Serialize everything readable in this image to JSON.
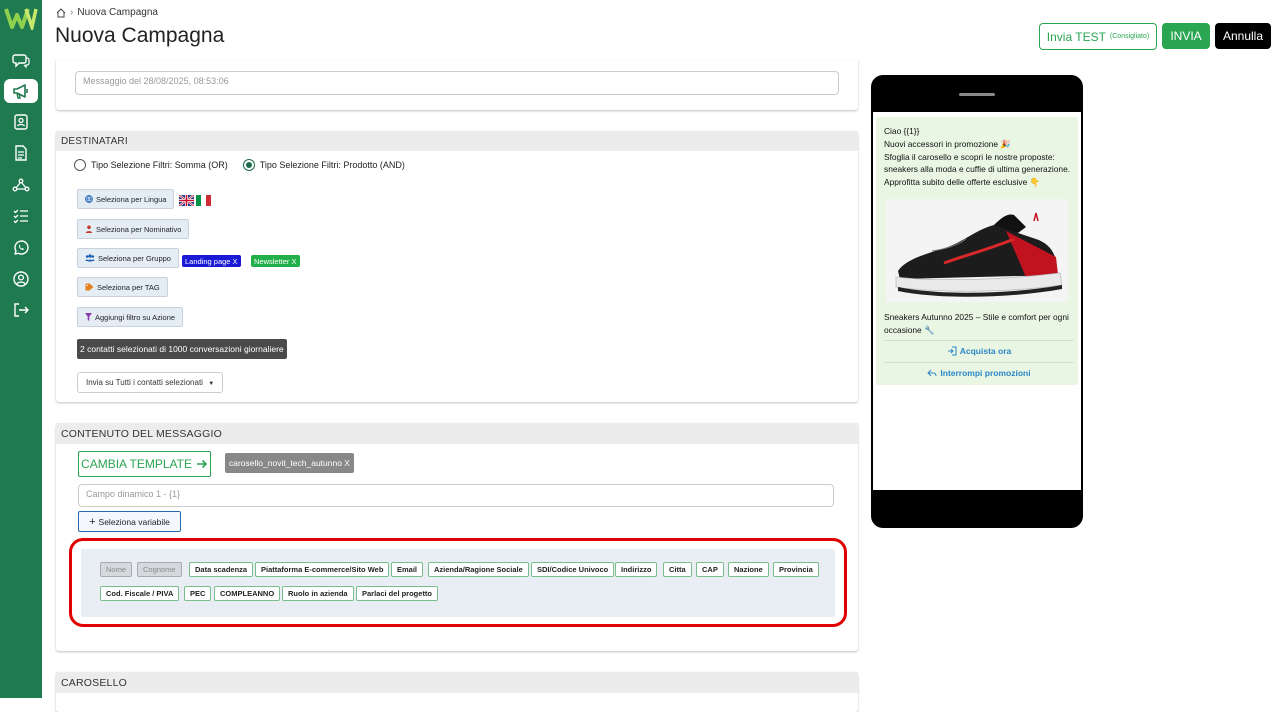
{
  "breadcrumb": {
    "current": "Nuova Campagna"
  },
  "header": {
    "title": "Nuova Campagna",
    "test_label": "Invia TEST",
    "test_hint": "(Consigliato)",
    "send_label": "INVIA",
    "cancel_label": "Annulla"
  },
  "sidebar": {
    "items": [
      "chat-icon",
      "megaphone-icon",
      "contacts-icon",
      "document-icon",
      "flow-icon",
      "checklist-icon",
      "whatsapp-icon",
      "user-icon",
      "logout-icon"
    ],
    "active": "megaphone-icon"
  },
  "colors": {
    "brand_green": "#1f7a4f",
    "accent_green": "#2aa552",
    "highlight_red": "#e00000",
    "tag_blue": "#1a1ad6",
    "tag_green": "#22b04a"
  },
  "message_card": {
    "field_value": "Messaggio del 28/08/2025, 08:53:06"
  },
  "destinatari": {
    "title": "DESTINATARI",
    "radio_or": "Tipo Selezione Filtri: Somma (OR)",
    "radio_and": "Tipo Selezione Filtri: Prodotto (AND)",
    "selected_radio": "and",
    "btn_lingua": "Seleziona per Lingua",
    "btn_nominativo": "Seleziona per Nominativo",
    "btn_gruppo": "Seleziona per Gruppo",
    "btn_tag": "Seleziona per TAG",
    "btn_azione": "Aggiungi filtro su Azione",
    "group_tags": [
      "Landing page X",
      "Newsletter X"
    ],
    "contacts_summary": "2 contatti selezionati di 1000 conversazioni giornaliere",
    "send_to": "Invia su Tutti i contatti selezionati"
  },
  "contenuto": {
    "title": "CONTENUTO DEL MESSAGGIO",
    "change_template": "CAMBIA TEMPLATE",
    "template_tag": "carosello_novit_tech_autunno  X",
    "dynamic_field_placeholder": "Campo dinamico 1 - {1}",
    "select_variable": "Seleziona variabile",
    "variables_row1": [
      "Nome",
      "Cognome",
      "Data scadenza",
      "Piattaforma E-commerce/Sito Web",
      "Email",
      "Azienda/Ragione Sociale",
      "SDI/Codice Univoco",
      "Indirizzo",
      "Citta",
      "CAP",
      "Nazione",
      "Provincia"
    ],
    "variables_row2": [
      "Cod. Fiscale / PIVA",
      "PEC",
      "COMPLEANNO",
      "Ruolo in azienda",
      "Parlaci del progetto"
    ],
    "disabled_variables": [
      "Nome",
      "Cognome"
    ]
  },
  "carosello": {
    "title": "CAROSELLO"
  },
  "preview": {
    "lines": [
      "Ciao {{1}}",
      "Nuovi accessori in promozione 🎉",
      "Sfoglia il carosello e scopri le nostre proposte: sneakers alla moda e cuffie di ultima generazione.",
      "Approfitta subito delle offerte esclusive 👇"
    ],
    "caption": "Sneakers Autunno 2025 – Stile e comfort per ogni occasione 🔧",
    "cta_buy": "Acquista ora",
    "cta_stop": "Interrompi promozioni"
  }
}
